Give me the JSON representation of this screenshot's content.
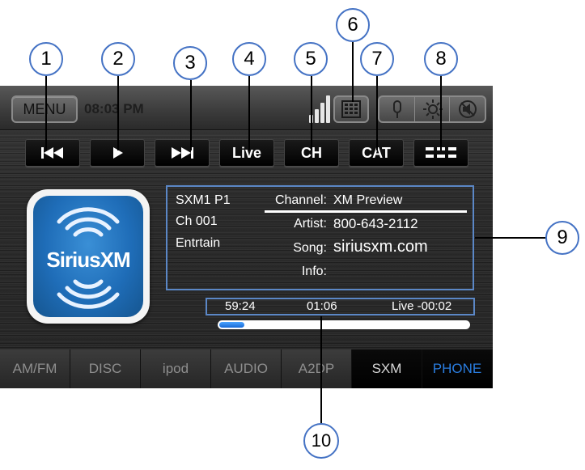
{
  "topbar": {
    "menu_label": "MENU",
    "time": "08:03 PM",
    "icons": [
      "signal-strength-icon",
      "keypad-icon",
      "microphone-icon",
      "brightness-icon",
      "mute-icon"
    ]
  },
  "controls": [
    {
      "id": "prev",
      "icon": "skip-back-icon",
      "label": ""
    },
    {
      "id": "play",
      "icon": "play-icon",
      "label": ""
    },
    {
      "id": "next",
      "icon": "skip-forward-icon",
      "label": ""
    },
    {
      "id": "live",
      "label": "Live"
    },
    {
      "id": "ch",
      "label": "CH"
    },
    {
      "id": "cat",
      "label": "CAT"
    },
    {
      "id": "list",
      "icon": "list-icon",
      "label": ""
    }
  ],
  "logo": {
    "text": "SiriusXM",
    "color": "#1f6db8"
  },
  "station": {
    "band": "SXM1 P1",
    "channel_number": "Ch 001",
    "category": "Entrtain"
  },
  "track_info": {
    "channel_label": "Channel:",
    "channel_value": "XM Preview",
    "artist_label": "Artist:",
    "artist_value": "800-643-2112",
    "song_label": "Song:",
    "song_value": "siriusxm.com",
    "info_label": "Info:",
    "info_value": ""
  },
  "progress": {
    "buffer": "59:24",
    "elapsed": "01:06",
    "live_offset": "Live -00:02",
    "fraction": 0.1
  },
  "tabs": [
    {
      "label": "AM/FM",
      "state": "normal"
    },
    {
      "label": "DISC",
      "state": "normal"
    },
    {
      "label": "ipod",
      "state": "normal"
    },
    {
      "label": "AUDIO",
      "state": "normal"
    },
    {
      "label": "A2DP",
      "state": "normal"
    },
    {
      "label": "SXM",
      "state": "active"
    },
    {
      "label": "PHONE",
      "state": "highlight"
    }
  ],
  "callouts": [
    "1",
    "2",
    "3",
    "4",
    "5",
    "6",
    "7",
    "8",
    "9",
    "10"
  ],
  "colors": {
    "accent_blue": "#2a7de0",
    "callout_border": "#4472c4",
    "box_outline": "#5b87c6"
  }
}
